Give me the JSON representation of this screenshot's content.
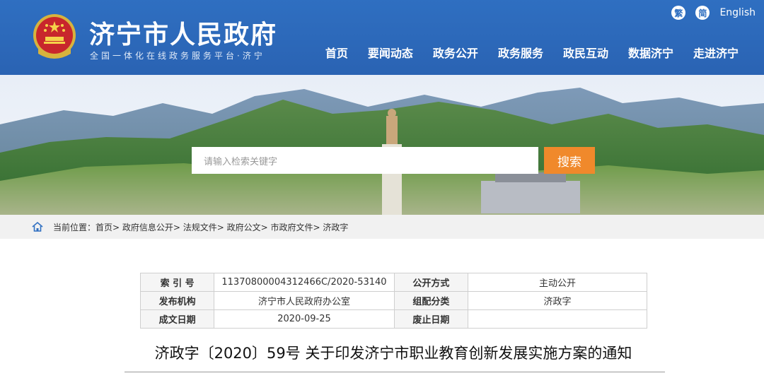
{
  "header": {
    "site_title": "济宁市人民政府",
    "site_subtitle": "全国一体化在线政务服务平台·济宁",
    "util": {
      "traditional": "繁",
      "simplified": "简",
      "english": "English"
    },
    "nav": [
      "首页",
      "要闻动态",
      "政务公开",
      "政务服务",
      "政民互动",
      "数据济宁",
      "走进济宁"
    ]
  },
  "search": {
    "placeholder": "请输入检索关键字",
    "button": "搜索"
  },
  "breadcrumb": {
    "text": "当前位置：首页> 政府信息公开> 法规文件> 政府公文> 市政府文件> 济政字"
  },
  "info": {
    "index_label": "索 引 号",
    "index_value": "11370800004312466C/2020-53140",
    "open_label": "公开方式",
    "open_value": "主动公开",
    "publisher_label": "发布机构",
    "publisher_value": "济宁市人民政府办公室",
    "category_label": "组配分类",
    "category_value": "济政字",
    "date_label": "成文日期",
    "date_value": "2020-09-25",
    "expire_label": "废止日期",
    "expire_value": ""
  },
  "document": {
    "title": "济政字〔2020〕59号 关于印发济宁市职业教育创新发展实施方案的通知"
  },
  "colors": {
    "header_blue": "#2f6fc1",
    "search_orange": "#f0892b",
    "breadcrumb_bg": "#f1f1f1"
  }
}
